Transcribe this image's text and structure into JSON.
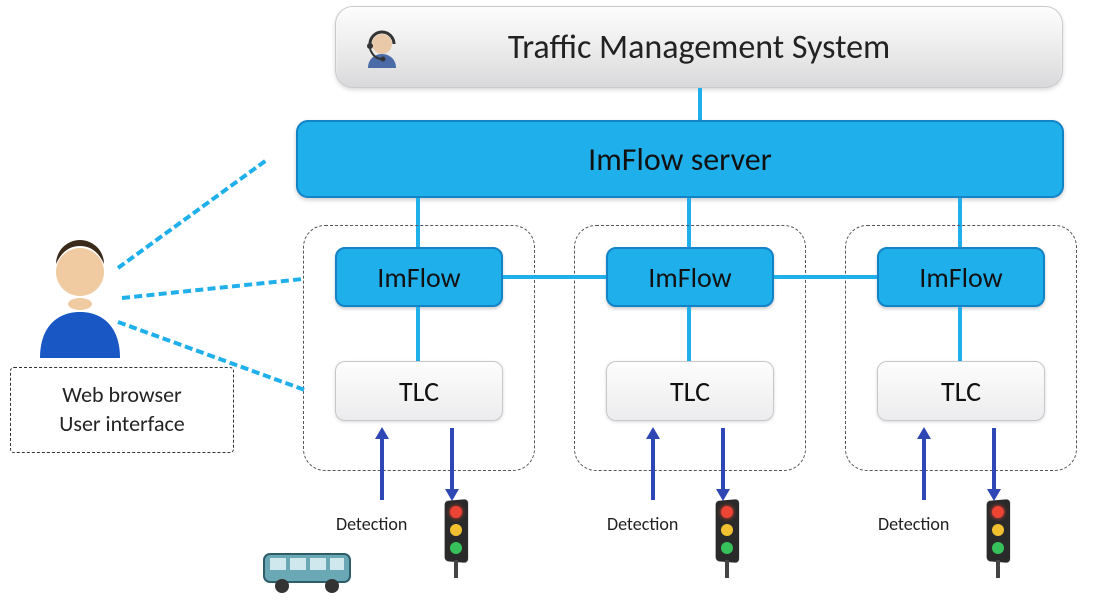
{
  "title": "Traffic Management System",
  "server": {
    "label": "ImFlow server"
  },
  "clusters": [
    {
      "imflow": "ImFlow",
      "tlc": "TLC",
      "detection_label": "Detection"
    },
    {
      "imflow": "ImFlow",
      "tlc": "TLC",
      "detection_label": "Detection"
    },
    {
      "imflow": "ImFlow",
      "tlc": "TLC",
      "detection_label": "Detection"
    }
  ],
  "user_caption": {
    "line1": "Web browser",
    "line2": "User interface"
  },
  "icons": {
    "operator": "operator-headset-icon",
    "user": "user-avatar-icon",
    "traffic_light": "traffic-light-icon",
    "bus": "bus-icon"
  },
  "colors": {
    "accent": "#1fb0ec",
    "accent_border": "#1283c5",
    "arrow": "#2f47b5"
  }
}
